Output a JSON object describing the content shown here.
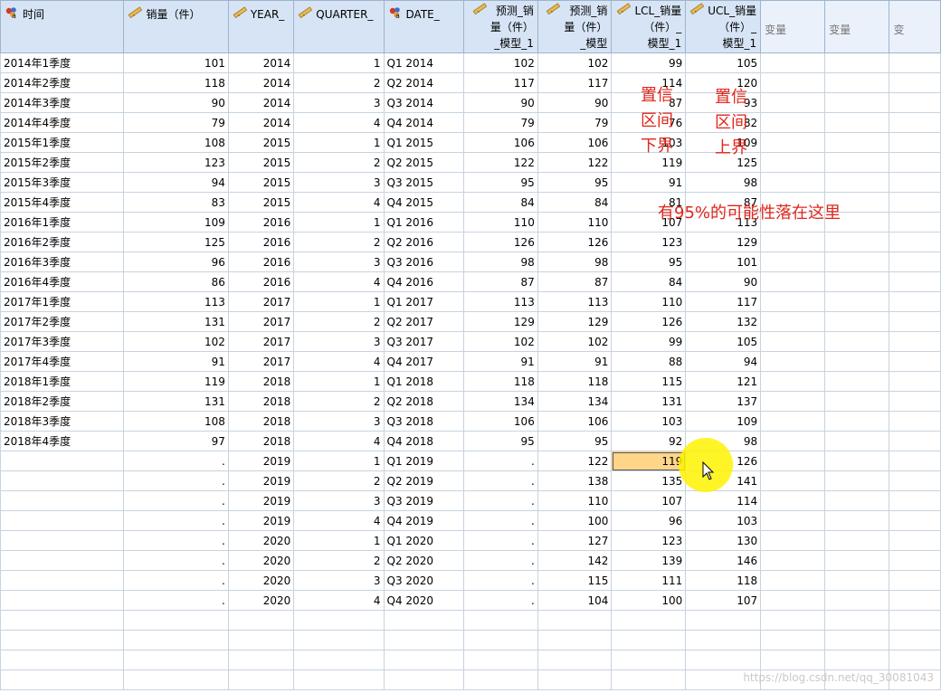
{
  "columns": [
    {
      "label": "时间",
      "icon": "nominal-string-icon",
      "align": "left",
      "width": 142
    },
    {
      "label": "销量（件）",
      "icon": "scale-measure-icon",
      "align": "left",
      "width": 118
    },
    {
      "label": "YEAR_",
      "icon": "scale-measure-icon",
      "align": "left",
      "width": 73
    },
    {
      "label": "QUARTER_",
      "icon": "scale-measure-icon",
      "align": "left",
      "width": 100
    },
    {
      "label": "DATE_",
      "icon": "nominal-string-icon",
      "align": "left",
      "width": 91
    },
    {
      "label": "预测_销\n量（件）\n_模型_1",
      "icon": "scale-measure-icon",
      "align": "right",
      "width": 82
    },
    {
      "label": "预测_销\n量（件）\n_模型",
      "icon": "scale-measure-icon",
      "align": "right",
      "width": 82
    },
    {
      "label": "LCL_销量\n（件）_\n模型_1",
      "icon": "scale-measure-icon",
      "align": "right",
      "width": 82
    },
    {
      "label": "UCL_销量\n（件）_\n模型_1",
      "icon": "scale-measure-icon",
      "align": "right",
      "width": 82
    },
    {
      "label": "变量",
      "icon": "",
      "align": "center",
      "width": 75
    },
    {
      "label": "变量",
      "icon": "",
      "align": "center",
      "width": 75
    },
    {
      "label": "变",
      "icon": "",
      "align": "center",
      "width": 60
    }
  ],
  "rows": [
    [
      "2014年1季度",
      "101",
      "2014",
      "1",
      "Q1 2014",
      "102",
      "102",
      "99",
      "105"
    ],
    [
      "2014年2季度",
      "118",
      "2014",
      "2",
      "Q2 2014",
      "117",
      "117",
      "114",
      "120"
    ],
    [
      "2014年3季度",
      "90",
      "2014",
      "3",
      "Q3 2014",
      "90",
      "90",
      "87",
      "93"
    ],
    [
      "2014年4季度",
      "79",
      "2014",
      "4",
      "Q4 2014",
      "79",
      "79",
      "76",
      "82"
    ],
    [
      "2015年1季度",
      "108",
      "2015",
      "1",
      "Q1 2015",
      "106",
      "106",
      "103",
      "109"
    ],
    [
      "2015年2季度",
      "123",
      "2015",
      "2",
      "Q2 2015",
      "122",
      "122",
      "119",
      "125"
    ],
    [
      "2015年3季度",
      "94",
      "2015",
      "3",
      "Q3 2015",
      "95",
      "95",
      "91",
      "98"
    ],
    [
      "2015年4季度",
      "83",
      "2015",
      "4",
      "Q4 2015",
      "84",
      "84",
      "81",
      "87"
    ],
    [
      "2016年1季度",
      "109",
      "2016",
      "1",
      "Q1 2016",
      "110",
      "110",
      "107",
      "113"
    ],
    [
      "2016年2季度",
      "125",
      "2016",
      "2",
      "Q2 2016",
      "126",
      "126",
      "123",
      "129"
    ],
    [
      "2016年3季度",
      "96",
      "2016",
      "3",
      "Q3 2016",
      "98",
      "98",
      "95",
      "101"
    ],
    [
      "2016年4季度",
      "86",
      "2016",
      "4",
      "Q4 2016",
      "87",
      "87",
      "84",
      "90"
    ],
    [
      "2017年1季度",
      "113",
      "2017",
      "1",
      "Q1 2017",
      "113",
      "113",
      "110",
      "117"
    ],
    [
      "2017年2季度",
      "131",
      "2017",
      "2",
      "Q2 2017",
      "129",
      "129",
      "126",
      "132"
    ],
    [
      "2017年3季度",
      "102",
      "2017",
      "3",
      "Q3 2017",
      "102",
      "102",
      "99",
      "105"
    ],
    [
      "2017年4季度",
      "91",
      "2017",
      "4",
      "Q4 2017",
      "91",
      "91",
      "88",
      "94"
    ],
    [
      "2018年1季度",
      "119",
      "2018",
      "1",
      "Q1 2018",
      "118",
      "118",
      "115",
      "121"
    ],
    [
      "2018年2季度",
      "131",
      "2018",
      "2",
      "Q2 2018",
      "134",
      "134",
      "131",
      "137"
    ],
    [
      "2018年3季度",
      "108",
      "2018",
      "3",
      "Q3 2018",
      "106",
      "106",
      "103",
      "109"
    ],
    [
      "2018年4季度",
      "97",
      "2018",
      "4",
      "Q4 2018",
      "95",
      "95",
      "92",
      "98"
    ],
    [
      "",
      ".",
      "2019",
      "1",
      "Q1 2019",
      ".",
      "122",
      "119",
      "126"
    ],
    [
      "",
      ".",
      "2019",
      "2",
      "Q2 2019",
      ".",
      "138",
      "135",
      "141"
    ],
    [
      "",
      ".",
      "2019",
      "3",
      "Q3 2019",
      ".",
      "110",
      "107",
      "114"
    ],
    [
      "",
      ".",
      "2019",
      "4",
      "Q4 2019",
      ".",
      "100",
      "96",
      "103"
    ],
    [
      "",
      ".",
      "2020",
      "1",
      "Q1 2020",
      ".",
      "127",
      "123",
      "130"
    ],
    [
      "",
      ".",
      "2020",
      "2",
      "Q2 2020",
      ".",
      "142",
      "139",
      "146"
    ],
    [
      "",
      ".",
      "2020",
      "3",
      "Q3 2020",
      ".",
      "115",
      "111",
      "118"
    ],
    [
      "",
      ".",
      "2020",
      "4",
      "Q4 2020",
      ".",
      "104",
      "100",
      "107"
    ],
    [
      "",
      "",
      "",
      "",
      "",
      "",
      "",
      "",
      ""
    ],
    [
      "",
      "",
      "",
      "",
      "",
      "",
      "",
      "",
      ""
    ],
    [
      "",
      "",
      "",
      "",
      "",
      "",
      "",
      "",
      ""
    ],
    [
      "",
      "",
      "",
      "",
      "",
      "",
      "",
      "",
      ""
    ]
  ],
  "selected_cell": {
    "row": 20,
    "col": 7
  },
  "annotations": {
    "lower_bound": "置信\n区间\n下界",
    "upper_bound": "置信\n区间\n上界",
    "probability_note": "有95%的可能性落在这里",
    "color": "#e0261b"
  },
  "watermark": "https://blog.csdn.net/qq_30081043",
  "colors": {
    "header_bg": "#d6e4f5",
    "selected_cell": "#ffd58a",
    "highlight_spot": "#fff200"
  }
}
